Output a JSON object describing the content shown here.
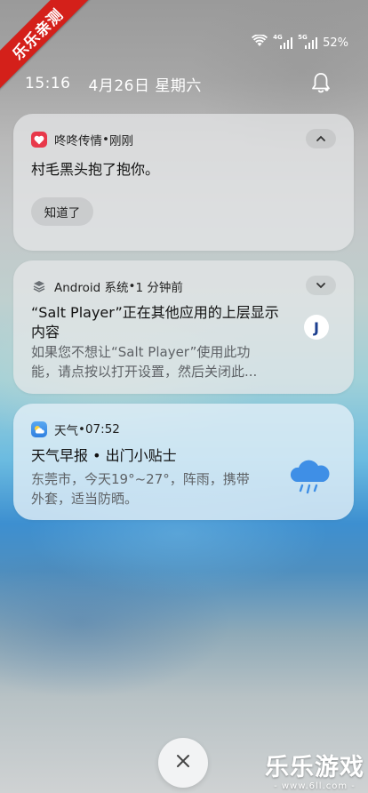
{
  "watermark": {
    "corner": "乐乐亲测",
    "bottom_title": "乐乐游戏",
    "bottom_url": "- www.6ll.com -"
  },
  "status": {
    "sim1_tag": "4G",
    "sim2_tag": "5G",
    "battery": "52%"
  },
  "header": {
    "time": "15:16",
    "date": "4月26日 星期六"
  },
  "notifications": [
    {
      "app": "咚咚传情",
      "sep": " • ",
      "when": "刚刚",
      "message": "村毛黑头抱了抱你。",
      "action": "知道了",
      "icon": "heart-icon",
      "icon_color": "#e8384a"
    },
    {
      "app": "Android 系统",
      "sep": " • ",
      "when": "1 分钟前",
      "title_line1": "“Salt Player”正在其他应用的上层显示",
      "title_line2": "内容",
      "body_line1": "如果您不想让“Salt Player”使用此功",
      "body_line2": "能，请点按以打开设置，然后关闭此...",
      "icon": "android-system-icon",
      "badge_letter": "J"
    },
    {
      "app": "天气",
      "sep": " • ",
      "when": "07:52",
      "title": "天气早报 • 出门小贴士",
      "body_line1": "东莞市，今天19°~27°，阵雨，携带",
      "body_line2": "外套，适当防晒。",
      "icon": "weather-icon",
      "icon_color": "#3b8ee8"
    }
  ]
}
